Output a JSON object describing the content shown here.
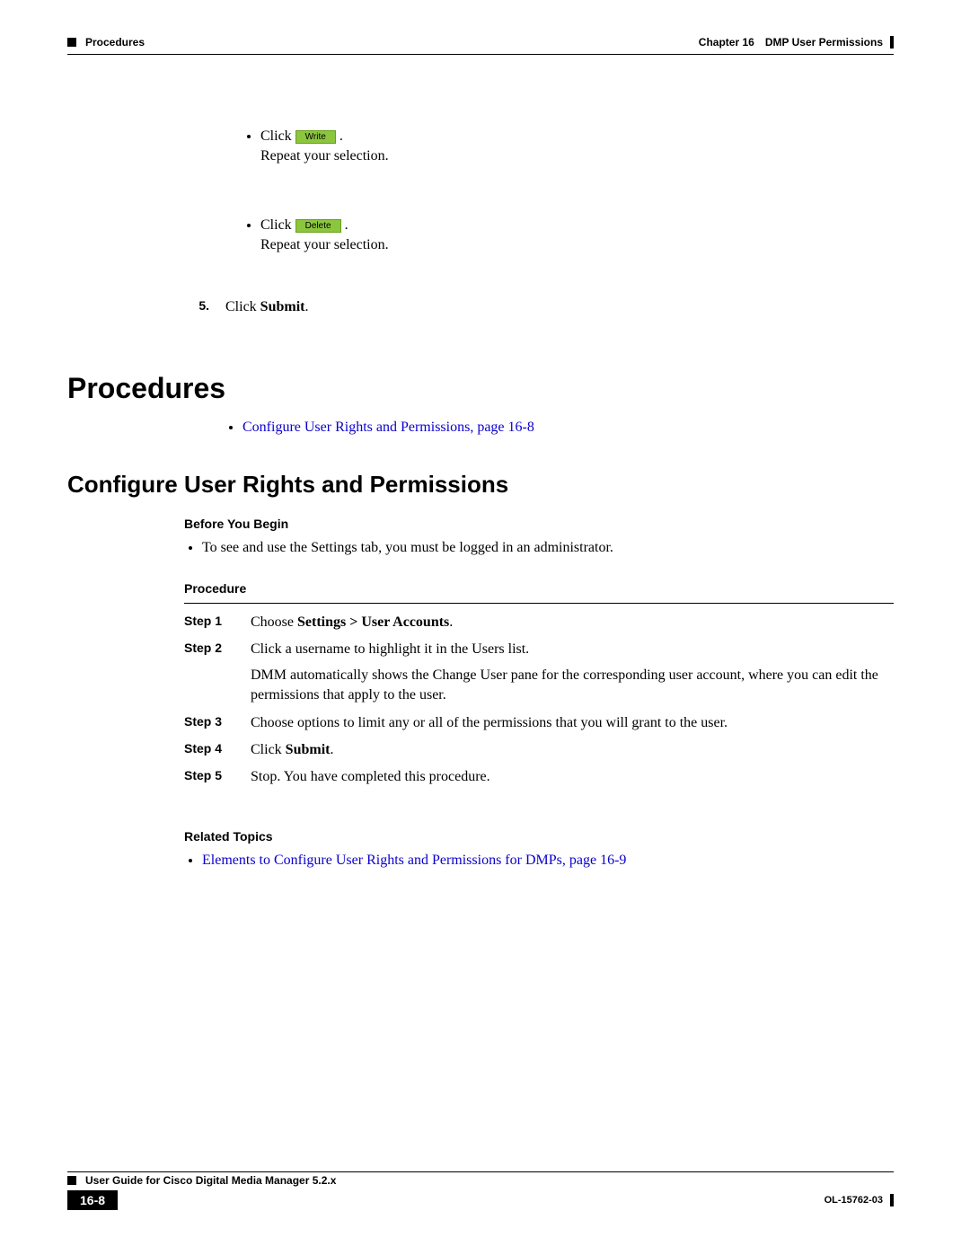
{
  "header": {
    "left": "Procedures",
    "chapter": "Chapter 16",
    "right_title": "DMP User Permissions"
  },
  "top": {
    "bullet1_click": "Click ",
    "btn_write": "Write",
    "bullet1_period": ".",
    "bullet1_line2": "Repeat your selection.",
    "bullet2_click": "Click ",
    "btn_delete": "Delete",
    "bullet2_period": ".",
    "bullet2_line2": "Repeat your selection.",
    "step5_num": "5.",
    "step5_text_a": "Click ",
    "step5_text_b": "Submit",
    "step5_text_c": "."
  },
  "h1": "Procedures",
  "h1_bullet_link": "Configure User Rights and Permissions, page 16-8",
  "h2": "Configure User Rights and Permissions",
  "before_you_begin": "Before You Begin",
  "before_bullet": "To see and use the Settings tab, you must be logged in an administrator.",
  "procedure_label": "Procedure",
  "steps": {
    "s1_lbl": "Step 1",
    "s1_a": "Choose ",
    "s1_b": "Settings > User Accounts",
    "s1_c": ".",
    "s2_lbl": "Step 2",
    "s2_a": "Click a username to highlight it in the Users list.",
    "s2_b": "DMM automatically shows the Change User pane for the corresponding user account, where you can edit the permissions that apply to the user.",
    "s3_lbl": "Step 3",
    "s3_a": "Choose options to limit any or all of the permissions that you will grant to the user.",
    "s4_lbl": "Step 4",
    "s4_a": "Click ",
    "s4_b": "Submit",
    "s4_c": ".",
    "s5_lbl": "Step 5",
    "s5_a": "Stop. You have completed this procedure."
  },
  "related_topics": "Related Topics",
  "related_bullet_link": "Elements to Configure User Rights and Permissions for DMPs, page 16-9",
  "footer": {
    "title": "User Guide for Cisco Digital Media Manager 5.2.x",
    "page_num": "16-8",
    "docnum": "OL-15762-03"
  }
}
